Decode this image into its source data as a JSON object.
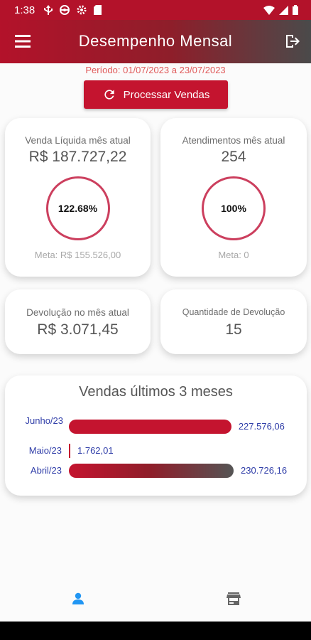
{
  "status_bar": {
    "time": "1:38"
  },
  "header": {
    "title": "Desempenho Mensal"
  },
  "period": "Período: 01/07/2023 a 23/07/2023",
  "process_button": {
    "label": "Processar Vendas"
  },
  "cards": {
    "net_sales": {
      "label": "Venda Líquida mês atual",
      "value": "R$ 187.727,22",
      "percent": "122.68%",
      "meta": "Meta: R$ 155.526,00"
    },
    "services": {
      "label": "Atendimentos mês atual",
      "value": "254",
      "percent": "100%",
      "meta": "Meta: 0"
    },
    "returns": {
      "label": "Devolução no mês atual",
      "value": "R$ 3.071,45"
    },
    "returns_qty": {
      "label": "Quantidade de Devolução",
      "value": "15"
    }
  },
  "chart_data": {
    "type": "bar",
    "title": "Vendas últimos 3 meses",
    "categories": [
      "Junho/23",
      "Maio/23",
      "Abril/23"
    ],
    "values": [
      227576.06,
      1762.01,
      230726.16
    ],
    "value_labels": [
      "227.576,06",
      "1.762,01",
      "230.726,16"
    ],
    "colors": [
      "#c4142f",
      "#c4142f",
      "gradient #c4142f→#555555"
    ]
  },
  "bottom_nav": {
    "items": [
      "profile-icon",
      "store-icon"
    ],
    "active": "profile-icon",
    "active_color": "#2196f3"
  }
}
